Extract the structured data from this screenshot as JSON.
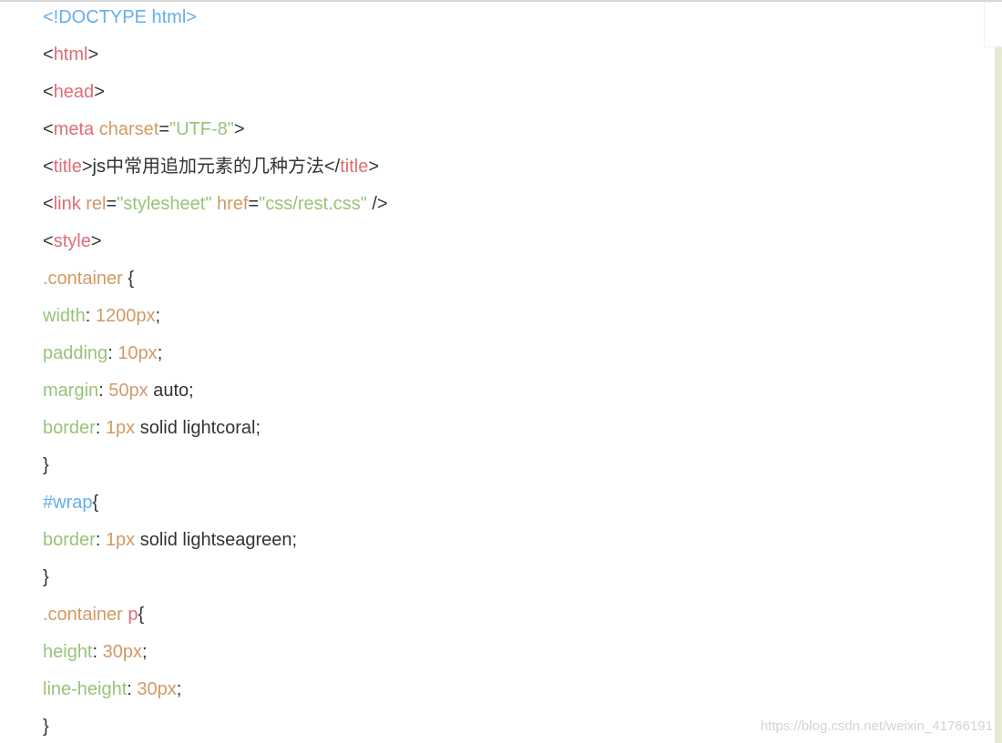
{
  "code": {
    "lines": [
      {
        "tokens": [
          {
            "t": "<!DOCTYPE html>",
            "k": "doctype"
          }
        ]
      },
      {
        "tokens": [
          {
            "t": "<",
            "k": "punct"
          },
          {
            "t": "html",
            "k": "tag"
          },
          {
            "t": ">",
            "k": "punct"
          }
        ]
      },
      {
        "tokens": [
          {
            "t": "<",
            "k": "punct"
          },
          {
            "t": "head",
            "k": "tag"
          },
          {
            "t": ">",
            "k": "punct"
          }
        ]
      },
      {
        "tokens": [
          {
            "t": "<",
            "k": "punct"
          },
          {
            "t": "meta",
            "k": "tag"
          },
          {
            "t": " ",
            "k": "punct"
          },
          {
            "t": "charset",
            "k": "attr"
          },
          {
            "t": "=",
            "k": "punct"
          },
          {
            "t": "\"UTF-8\"",
            "k": "string"
          },
          {
            "t": ">",
            "k": "punct"
          }
        ]
      },
      {
        "tokens": [
          {
            "t": "<",
            "k": "punct"
          },
          {
            "t": "title",
            "k": "tag"
          },
          {
            "t": ">",
            "k": "punct"
          },
          {
            "t": "js中常用追加元素的几种方法",
            "k": "text"
          },
          {
            "t": "</",
            "k": "punct"
          },
          {
            "t": "title",
            "k": "tag"
          },
          {
            "t": ">",
            "k": "punct"
          }
        ]
      },
      {
        "tokens": [
          {
            "t": "<",
            "k": "punct"
          },
          {
            "t": "link",
            "k": "tag"
          },
          {
            "t": " ",
            "k": "punct"
          },
          {
            "t": "rel",
            "k": "attr"
          },
          {
            "t": "=",
            "k": "punct"
          },
          {
            "t": "\"stylesheet\"",
            "k": "string"
          },
          {
            "t": " ",
            "k": "punct"
          },
          {
            "t": "href",
            "k": "attr"
          },
          {
            "t": "=",
            "k": "punct"
          },
          {
            "t": "\"css/rest.css\"",
            "k": "string"
          },
          {
            "t": " />",
            "k": "punct"
          }
        ]
      },
      {
        "tokens": [
          {
            "t": "<",
            "k": "punct"
          },
          {
            "t": "style",
            "k": "tag"
          },
          {
            "t": ">",
            "k": "punct"
          }
        ]
      },
      {
        "tokens": [
          {
            "t": ".container",
            "k": "class"
          },
          {
            "t": " {",
            "k": "punct"
          }
        ]
      },
      {
        "tokens": [
          {
            "t": "width",
            "k": "prop"
          },
          {
            "t": ": ",
            "k": "punct"
          },
          {
            "t": "1200px",
            "k": "number"
          },
          {
            "t": ";",
            "k": "punct"
          }
        ]
      },
      {
        "tokens": [
          {
            "t": "padding",
            "k": "prop"
          },
          {
            "t": ": ",
            "k": "punct"
          },
          {
            "t": "10px",
            "k": "number"
          },
          {
            "t": ";",
            "k": "punct"
          }
        ]
      },
      {
        "tokens": [
          {
            "t": "margin",
            "k": "prop"
          },
          {
            "t": ": ",
            "k": "punct"
          },
          {
            "t": "50px",
            "k": "number"
          },
          {
            "t": " auto;",
            "k": "text"
          }
        ]
      },
      {
        "tokens": [
          {
            "t": "border",
            "k": "prop"
          },
          {
            "t": ": ",
            "k": "punct"
          },
          {
            "t": "1px",
            "k": "number"
          },
          {
            "t": " solid lightcoral;",
            "k": "text"
          }
        ]
      },
      {
        "tokens": [
          {
            "t": "}",
            "k": "punct"
          }
        ]
      },
      {
        "tokens": [
          {
            "t": "#wrap",
            "k": "id"
          },
          {
            "t": "{",
            "k": "punct"
          }
        ]
      },
      {
        "tokens": [
          {
            "t": "border",
            "k": "prop"
          },
          {
            "t": ": ",
            "k": "punct"
          },
          {
            "t": "1px",
            "k": "number"
          },
          {
            "t": " solid lightseagreen;",
            "k": "text"
          }
        ]
      },
      {
        "tokens": [
          {
            "t": "}",
            "k": "punct"
          }
        ]
      },
      {
        "tokens": [
          {
            "t": ".container",
            "k": "class"
          },
          {
            "t": " ",
            "k": "punct"
          },
          {
            "t": "p",
            "k": "tag"
          },
          {
            "t": "{",
            "k": "punct"
          }
        ]
      },
      {
        "tokens": [
          {
            "t": "height",
            "k": "prop"
          },
          {
            "t": ": ",
            "k": "punct"
          },
          {
            "t": "30px",
            "k": "number"
          },
          {
            "t": ";",
            "k": "punct"
          }
        ]
      },
      {
        "tokens": [
          {
            "t": "line-height",
            "k": "prop"
          },
          {
            "t": ": ",
            "k": "punct"
          },
          {
            "t": "30px",
            "k": "number"
          },
          {
            "t": ";",
            "k": "punct"
          }
        ]
      },
      {
        "tokens": [
          {
            "t": "}",
            "k": "punct"
          }
        ]
      }
    ]
  },
  "watermark": {
    "text": "https://blog.csdn.net/weixin_41766191"
  },
  "colors": {
    "tag": "#e06c75",
    "attr": "#d19a66",
    "string": "#98c379",
    "doctype": "#61afef",
    "property": "#98c379",
    "number": "#d19a66",
    "selector_class": "#d19a66",
    "selector_id": "#61afef",
    "text": "#333333",
    "scrollbar_track": "#e6ead6"
  }
}
